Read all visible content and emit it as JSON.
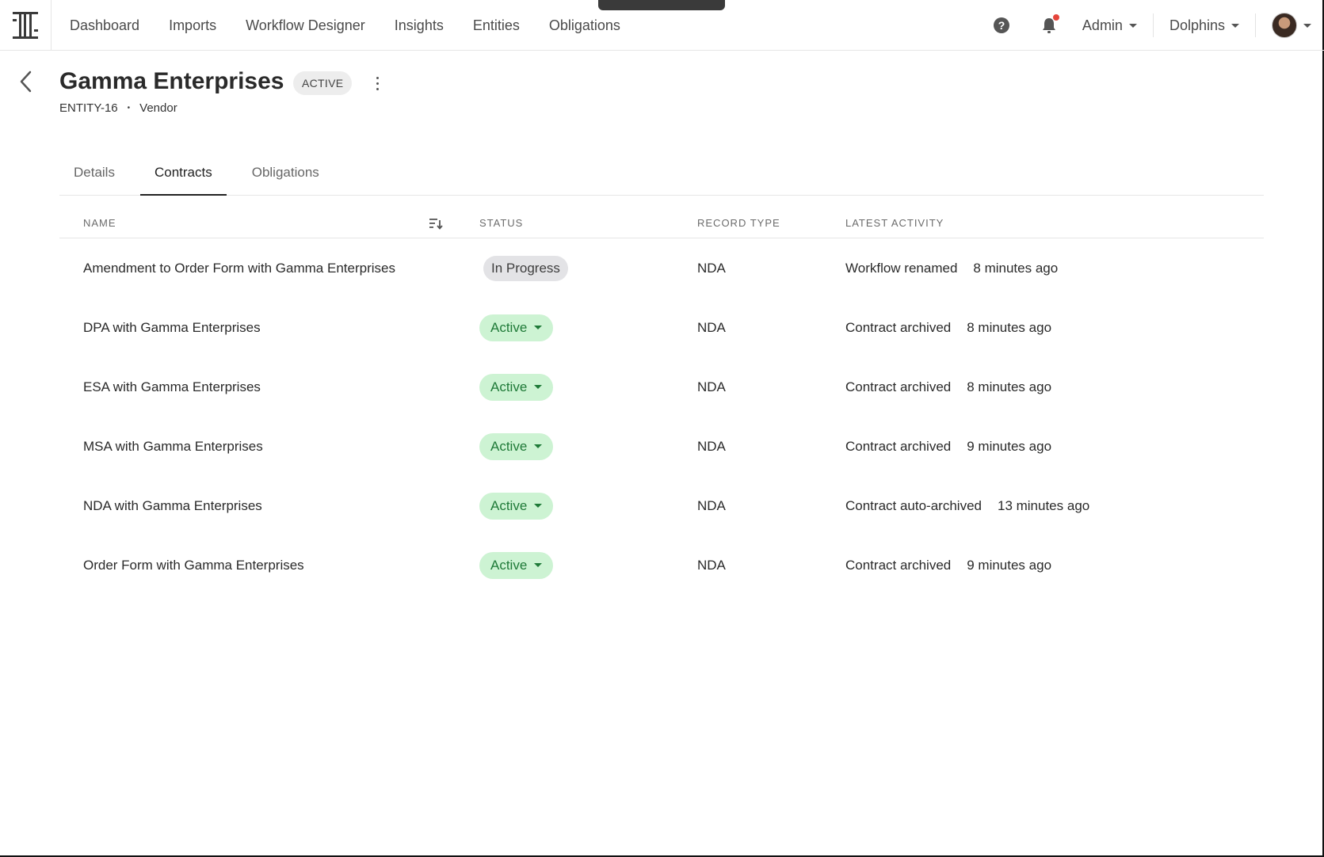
{
  "nav": {
    "items": [
      "Dashboard",
      "Imports",
      "Workflow Designer",
      "Insights",
      "Entities",
      "Obligations"
    ],
    "admin_label": "Admin",
    "org_label": "Dolphins"
  },
  "entity": {
    "title": "Gamma Enterprises",
    "status": "ACTIVE",
    "id": "ENTITY-16",
    "separator": "•",
    "type": "Vendor"
  },
  "tabs": [
    {
      "label": "Details",
      "active": false
    },
    {
      "label": "Contracts",
      "active": true
    },
    {
      "label": "Obligations",
      "active": false
    }
  ],
  "table": {
    "headers": {
      "name": "NAME",
      "status": "STATUS",
      "record_type": "RECORD TYPE",
      "latest_activity": "LATEST ACTIVITY"
    },
    "rows": [
      {
        "name": "Amendment to Order Form with Gamma Enterprises",
        "status": "In Progress",
        "status_kind": "progress",
        "record_type": "NDA",
        "activity": "Workflow renamed",
        "time": "8 minutes ago"
      },
      {
        "name": "DPA with Gamma Enterprises",
        "status": "Active",
        "status_kind": "active",
        "record_type": "NDA",
        "activity": "Contract archived",
        "time": "8 minutes ago"
      },
      {
        "name": "ESA with Gamma Enterprises",
        "status": "Active",
        "status_kind": "active",
        "record_type": "NDA",
        "activity": "Contract archived",
        "time": "8 minutes ago"
      },
      {
        "name": "MSA with Gamma Enterprises",
        "status": "Active",
        "status_kind": "active",
        "record_type": "NDA",
        "activity": "Contract archived",
        "time": "9 minutes ago"
      },
      {
        "name": "NDA with Gamma Enterprises",
        "status": "Active",
        "status_kind": "active",
        "record_type": "NDA",
        "activity": "Contract auto-archived",
        "time": "13 minutes ago"
      },
      {
        "name": "Order Form with Gamma Enterprises",
        "status": "Active",
        "status_kind": "active",
        "record_type": "NDA",
        "activity": "Contract archived",
        "time": "9 minutes ago"
      }
    ]
  },
  "icons": {
    "logo": "app-logo-icon",
    "help": "help-circle-icon",
    "bell": "bell-icon",
    "back": "chevron-left-icon",
    "more": "kebab-menu-icon",
    "sort": "sort-icon"
  },
  "colors": {
    "active_pill_bg": "#cdf3d3",
    "active_pill_text": "#1f7a38",
    "progress_pill_bg": "#e3e3e6",
    "notification_dot": "#e5453b"
  }
}
